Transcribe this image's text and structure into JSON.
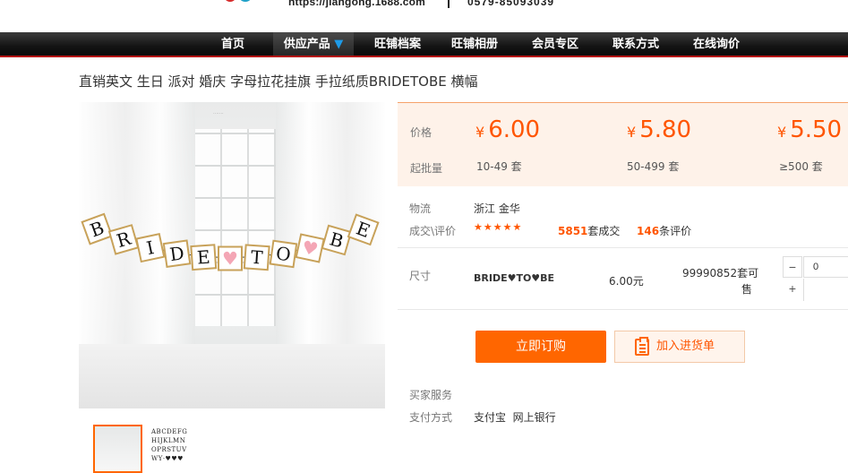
{
  "header": {
    "url_text": "https://jiangong.1688.com",
    "phone_text": "0579-85093039"
  },
  "nav": [
    {
      "label": "首页"
    },
    {
      "label": "供应产品",
      "arrow": "▼"
    },
    {
      "label": "旺铺档案"
    },
    {
      "label": "旺铺相册"
    },
    {
      "label": "会员专区"
    },
    {
      "label": "联系方式"
    },
    {
      "label": "在线询价"
    }
  ],
  "product": {
    "title": "直销英文 生日 派对 婚庆 字母拉花挂旗 手拉纸质BRIDETOBE 横幅",
    "banner_letters": [
      "B",
      "R",
      "I",
      "D",
      "E",
      "♥",
      "T",
      "O",
      "♥",
      "B",
      "E"
    ]
  },
  "pricing": {
    "price_label": "价格",
    "qty_label": "起批量",
    "currency": "¥",
    "tiers": [
      {
        "price": "6.00",
        "qty": "10-49 套"
      },
      {
        "price": "5.80",
        "qty": "50-499 套"
      },
      {
        "price": "5.50",
        "qty": "≥500 套"
      }
    ],
    "accent_color": "#ff5500"
  },
  "logistics": {
    "label": "物流",
    "value": "浙江 金华"
  },
  "reviews": {
    "label": "成交\\评价",
    "stars": "★★★★★",
    "deals_count": "5851",
    "deals_suffix": "套成交",
    "reviews_count": "146",
    "reviews_suffix": "条评价"
  },
  "spec": {
    "label": "尺寸",
    "name": "BRIDE♥TO♥BE",
    "price": "6.00元",
    "stock_line1": "99990852套可",
    "stock_line2": "售",
    "quantity": "0",
    "minus": "−",
    "plus": "+"
  },
  "actions": {
    "order_label": "立即订购",
    "cart_label": "加入进货单"
  },
  "services": {
    "buyer_label": "买家服务",
    "payment_label": "支付方式",
    "payment_values": "支付宝  网上银行"
  },
  "thumbnails": {
    "alphabet_preview": [
      "ABCDEFG",
      "HIJKLMN",
      "OPRSTUV",
      "WY·♥♥♥"
    ]
  }
}
